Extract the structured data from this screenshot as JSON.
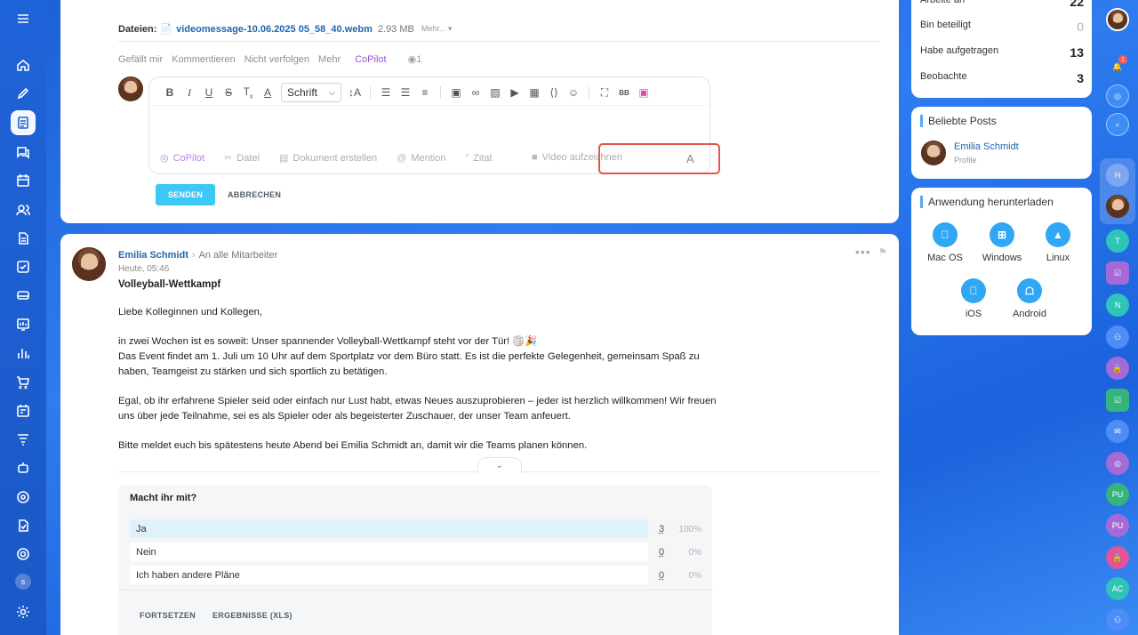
{
  "left_sidebar": {
    "icons": [
      "menu-icon",
      "home-icon",
      "feed-icon",
      "tasks-icon",
      "chat-icon",
      "calendar-icon",
      "contacts-icon",
      "documents-icon",
      "checklist-icon",
      "drive-icon",
      "analytics-icon",
      "reports-icon",
      "cart-icon",
      "planner-icon",
      "filter-icon",
      "robot-icon",
      "target-icon",
      "notes-icon",
      "lifebuoy-icon",
      "settings-icon"
    ],
    "user_initial": "s"
  },
  "composer": {
    "files_label": "Dateien:",
    "file_name": "videomessage-10.06.2025 05_58_40.webm",
    "file_size": "2.93 MB",
    "file_more": "Mehr...",
    "actions": [
      "Gefällt mir",
      "Kommentieren",
      "Nicht verfolgen",
      "Mehr"
    ],
    "copilot_label": "CoPilot",
    "views": "1",
    "toolbar": {
      "font_label": "Schrift"
    },
    "bottom": {
      "copilot": "CoPilot",
      "file": "Datei",
      "document": "Dokument erstellen",
      "mention": "Mention",
      "quote": "Zitat",
      "video": "Video aufzeichnen",
      "format": "A"
    },
    "send_label": "SENDEN",
    "cancel_label": "ABBRECHEN"
  },
  "post": {
    "author": "Emilia Schmidt",
    "target": "An alle Mitarbeiter",
    "time": "Heute, 05:46",
    "title": "Volleyball-Wettkampf",
    "p1": "Liebe Kolleginnen und Kollegen,",
    "p2a": "in zwei Wochen ist es soweit: Unser spannender Volleyball-Wettkampf steht vor der Tür! 🏐🎉",
    "p2b": "Das Event findet am 1. Juli um 10 Uhr auf dem Sportplatz vor dem Büro statt. Es ist die perfekte Gelegenheit, gemeinsam Spaß zu haben, Teamgeist zu stärken und sich sportlich zu betätigen.",
    "p3": "Egal, ob ihr erfahrene Spieler seid oder einfach nur Lust habt, etwas Neues auszuprobieren – jeder ist herzlich willkommen! Wir freuen uns über jede Teilnahme, sei es als Spieler oder als begeisterter Zuschauer, der unser Team anfeuert.",
    "p4": "Bitte meldet euch bis spätestens heute Abend bei Emilia Schmidt an, damit wir die Teams planen können.",
    "poll": {
      "question": "Macht ihr mit?",
      "options": [
        {
          "label": "Ja",
          "count": "3",
          "percent": "100%"
        },
        {
          "label": "Nein",
          "count": "0",
          "percent": "0%"
        },
        {
          "label": "Ich haben andere Pläne",
          "count": "0",
          "percent": "0%"
        }
      ],
      "continue_label": "FORTSETZEN",
      "results_label": "ERGEBNISSE (XLS)"
    }
  },
  "stats": {
    "rows": [
      {
        "label": "Arbeite an",
        "value": "22"
      },
      {
        "label": "Bin beteiligt",
        "value": "0"
      },
      {
        "label": "Habe aufgetragen",
        "value": "13"
      },
      {
        "label": "Beobachte",
        "value": "3"
      }
    ]
  },
  "popular": {
    "title": "Beliebte Posts",
    "name": "Emilia Schmidt",
    "sub": "Profile"
  },
  "download": {
    "title": "Anwendung herunterladen",
    "platforms": [
      "Mac OS",
      "Windows",
      "Linux",
      "iOS",
      "Android"
    ]
  },
  "right_bar": {
    "notification_count": "1",
    "items": [
      "H",
      "T",
      "N",
      "PU",
      "PU",
      "AC"
    ]
  }
}
